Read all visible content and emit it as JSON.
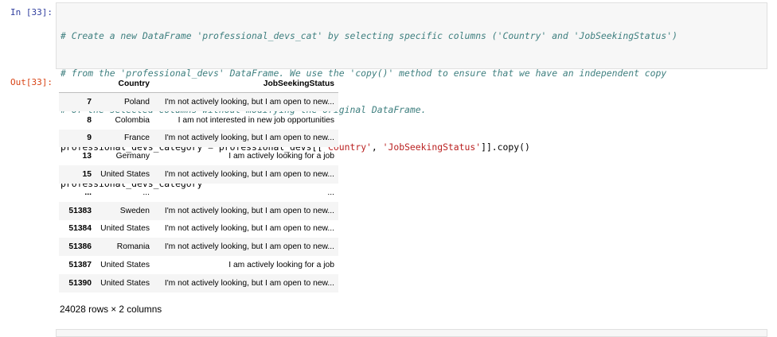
{
  "cell": {
    "in_prompt": "In [33]:",
    "out_prompt": "Out[33]:",
    "code": {
      "comment_1": "# Create a new DataFrame 'professional_devs_cat' by selecting specific columns ('Country' and 'JobSeekingStatus')",
      "comment_2": "# from the 'professional_devs' DataFrame. We use the 'copy()' method to ensure that we have an independent copy",
      "comment_3": "# of the selected columns without modifying the original DataFrame.",
      "line4_var": "professional_devs_category ",
      "line4_eq": "=",
      "line4_mid": " professional_devs[[",
      "line4_str1": "'Country'",
      "line4_comma": ", ",
      "line4_str2": "'JobSeekingStatus'",
      "line4_end": "]].copy()",
      "line5": "professional_devs_category"
    }
  },
  "dataframe": {
    "columns": [
      "",
      "Country",
      "JobSeekingStatus"
    ],
    "rows": [
      {
        "index": "7",
        "country": "Poland",
        "status": "I'm not actively looking, but I am open to new..."
      },
      {
        "index": "8",
        "country": "Colombia",
        "status": "I am not interested in new job opportunities"
      },
      {
        "index": "9",
        "country": "France",
        "status": "I'm not actively looking, but I am open to new..."
      },
      {
        "index": "13",
        "country": "Germany",
        "status": "I am actively looking for a job"
      },
      {
        "index": "15",
        "country": "United States",
        "status": "I'm not actively looking, but I am open to new..."
      },
      {
        "index": "...",
        "country": "...",
        "status": "..."
      },
      {
        "index": "51383",
        "country": "Sweden",
        "status": "I'm not actively looking, but I am open to new..."
      },
      {
        "index": "51384",
        "country": "United States",
        "status": "I'm not actively looking, but I am open to new..."
      },
      {
        "index": "51386",
        "country": "Romania",
        "status": "I'm not actively looking, but I am open to new..."
      },
      {
        "index": "51387",
        "country": "United States",
        "status": "I am actively looking for a job"
      },
      {
        "index": "51390",
        "country": "United States",
        "status": "I'm not actively looking, but I am open to new..."
      }
    ],
    "shape": "24028 rows × 2 columns"
  }
}
